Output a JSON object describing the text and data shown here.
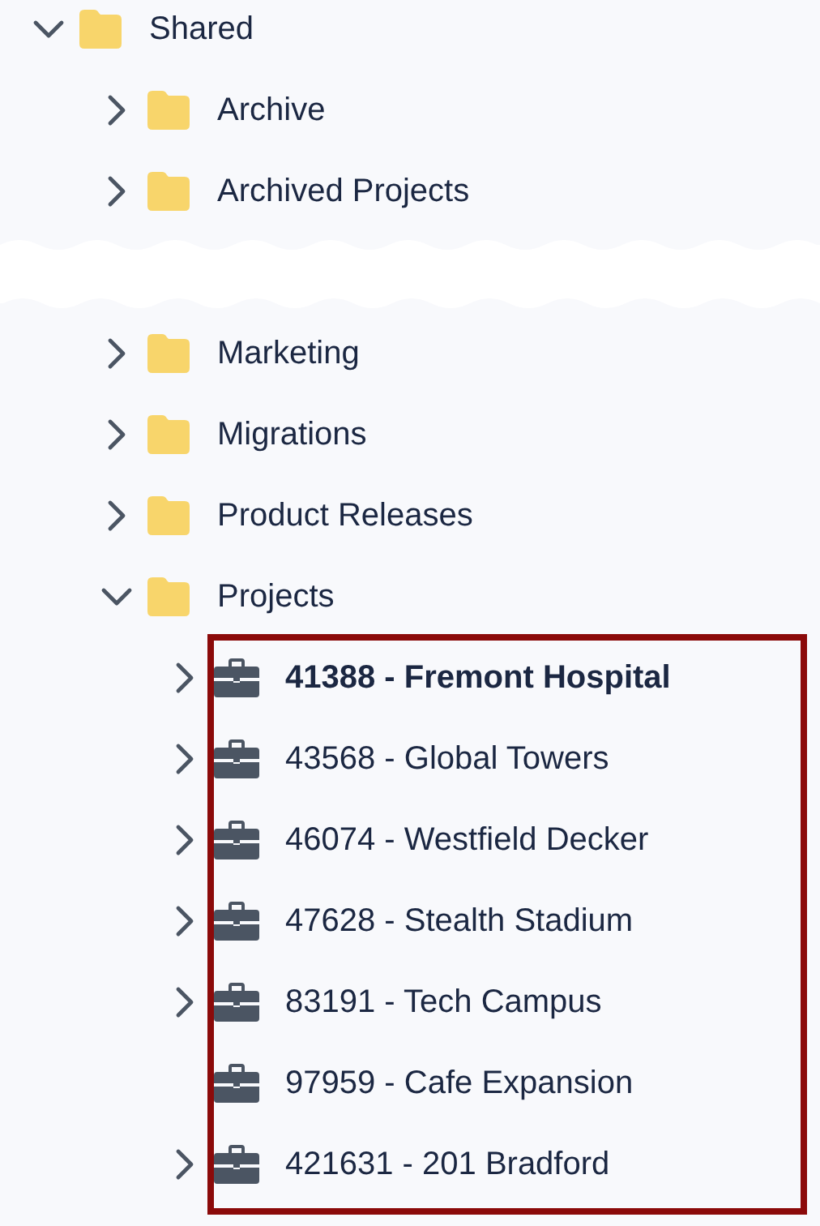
{
  "tree": [
    {
      "kind": "folder",
      "label": "Shared",
      "expanded": true,
      "children": [
        {
          "kind": "folder",
          "label": "Archive",
          "expanded": false
        },
        {
          "kind": "folder",
          "label": "Archived Projects",
          "expanded": false
        },
        {
          "kind": "break"
        },
        {
          "kind": "folder",
          "label": "Marketing",
          "expanded": false
        },
        {
          "kind": "folder",
          "label": "Migrations",
          "expanded": false
        },
        {
          "kind": "folder",
          "label": "Product Releases",
          "expanded": false
        },
        {
          "kind": "folder",
          "label": "Projects",
          "expanded": true,
          "children_highlighted": true,
          "children": [
            {
              "kind": "project",
              "label": "41388 - Fremont Hospital",
              "expandable": true,
              "selected": true
            },
            {
              "kind": "project",
              "label": "43568 - Global Towers",
              "expandable": true,
              "selected": false
            },
            {
              "kind": "project",
              "label": "46074 - Westfield Decker",
              "expandable": true,
              "selected": false
            },
            {
              "kind": "project",
              "label": "47628 - Stealth Stadium",
              "expandable": true,
              "selected": false
            },
            {
              "kind": "project",
              "label": "83191 - Tech Campus",
              "expandable": true,
              "selected": false
            },
            {
              "kind": "project",
              "label": "97959 - Cafe Expansion",
              "expandable": false,
              "selected": false
            },
            {
              "kind": "project",
              "label": "421631 - 201 Bradford",
              "expandable": true,
              "selected": false
            }
          ]
        }
      ]
    }
  ]
}
